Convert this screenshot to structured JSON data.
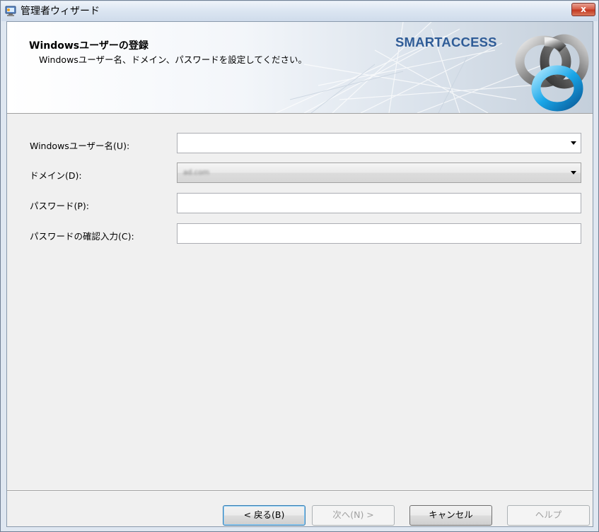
{
  "window": {
    "title": "管理者ウィザード",
    "close_label": "x"
  },
  "header": {
    "title": "Windowsユーザーの登録",
    "subtitle": "Windowsユーザー名、ドメイン、パスワードを設定してください。",
    "brand": "SMARTACCESS",
    "logo_icon": "interlocked-rings-logo"
  },
  "form": {
    "username": {
      "label": "Windowsユーザー名(U):",
      "value": ""
    },
    "domain": {
      "label": "ドメイン(D):",
      "value": "ad.com"
    },
    "password": {
      "label": "パスワード(P):",
      "value": ""
    },
    "password_confirm": {
      "label": "パスワードの確認入力(C):",
      "value": ""
    }
  },
  "buttons": {
    "back": "< 戻る(B)",
    "next": "次へ(N) >",
    "cancel": "キャンセル",
    "help": "ヘルプ"
  },
  "colors": {
    "brand": "#2f5c97",
    "close_button": "#c2361f",
    "default_button_border": "#3c7fb1"
  }
}
